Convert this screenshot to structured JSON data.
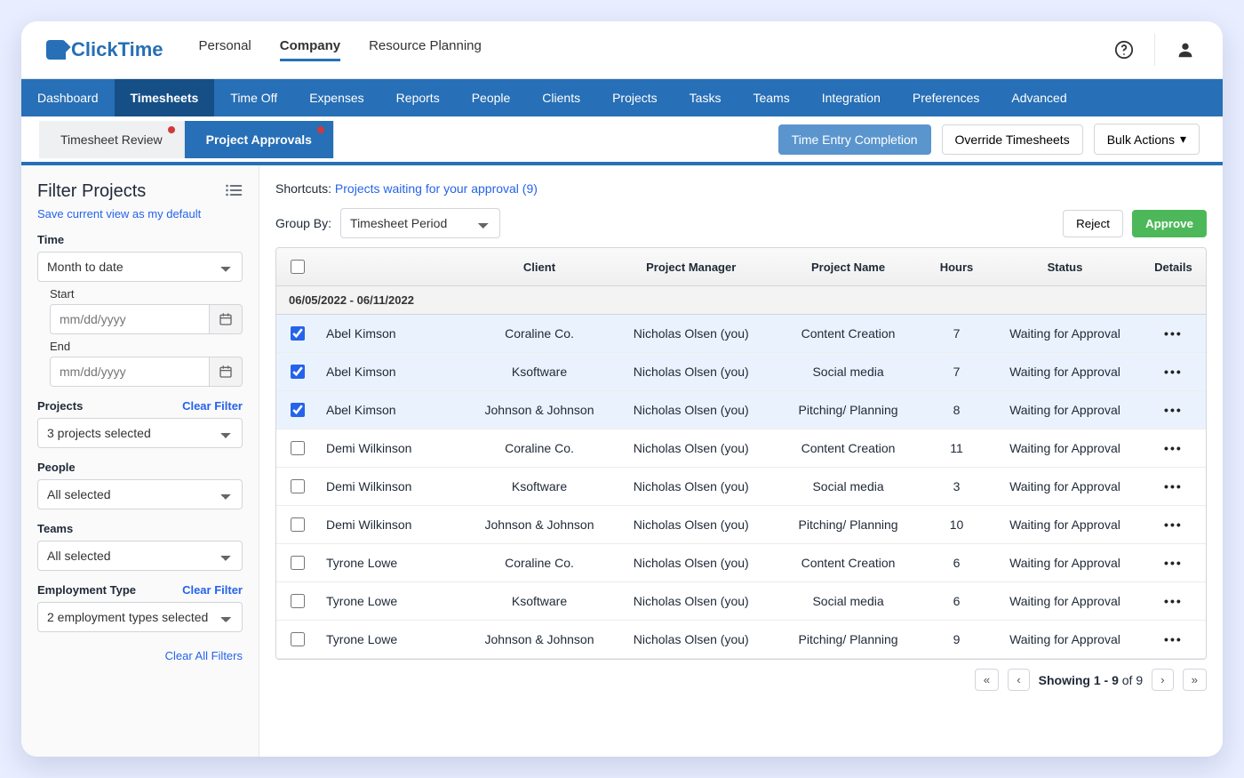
{
  "brand": "ClickTime",
  "topnav": {
    "items": [
      "Personal",
      "Company",
      "Resource Planning"
    ],
    "active": 1
  },
  "navbar": {
    "items": [
      "Dashboard",
      "Timesheets",
      "Time Off",
      "Expenses",
      "Reports",
      "People",
      "Clients",
      "Projects",
      "Tasks",
      "Teams",
      "Integration",
      "Preferences",
      "Advanced"
    ],
    "active": 1
  },
  "subtabs": {
    "items": [
      {
        "label": "Timesheet Review",
        "badge": true
      },
      {
        "label": "Project Approvals",
        "badge": true
      }
    ],
    "active": 1
  },
  "subbar_buttons": {
    "time_entry": "Time Entry Completion",
    "override": "Override Timesheets",
    "bulk": "Bulk Actions"
  },
  "sidebar": {
    "title": "Filter Projects",
    "save_default": "Save current view as my default",
    "clear_filter": "Clear Filter",
    "clear_all": "Clear All Filters",
    "time": {
      "label": "Time",
      "value": "Month to date",
      "start_label": "Start",
      "end_label": "End",
      "date_ph": "mm/dd/yyyy"
    },
    "projects": {
      "label": "Projects",
      "value": "3 projects selected"
    },
    "people": {
      "label": "People",
      "value": "All selected"
    },
    "teams": {
      "label": "Teams",
      "value": "All selected"
    },
    "emp_type": {
      "label": "Employment Type",
      "value": "2 employment types selected"
    }
  },
  "main": {
    "shortcut_label": "Shortcuts:",
    "shortcut_link": "Projects waiting for your approval (9)",
    "groupby_label": "Group By:",
    "groupby_value": "Timesheet Period",
    "reject": "Reject",
    "approve": "Approve"
  },
  "table": {
    "headers": [
      "",
      "",
      "Client",
      "Project Manager",
      "Project Name",
      "Hours",
      "Status",
      "Details"
    ],
    "group": "06/05/2022 - 06/11/2022",
    "rows": [
      {
        "sel": true,
        "person": "Abel Kimson",
        "client": "Coraline Co.",
        "pm": "Nicholas Olsen (you)",
        "project": "Content Creation",
        "hours": "7",
        "status": "Waiting for Approval"
      },
      {
        "sel": true,
        "person": "Abel Kimson",
        "client": "Ksoftware",
        "pm": "Nicholas Olsen (you)",
        "project": "Social media",
        "hours": "7",
        "status": "Waiting for Approval"
      },
      {
        "sel": true,
        "person": "Abel Kimson",
        "client": "Johnson & Johnson",
        "pm": "Nicholas Olsen (you)",
        "project": "Pitching/ Planning",
        "hours": "8",
        "status": "Waiting for Approval"
      },
      {
        "sel": false,
        "person": "Demi Wilkinson",
        "client": "Coraline Co.",
        "pm": "Nicholas Olsen (you)",
        "project": "Content Creation",
        "hours": "11",
        "status": "Waiting for Approval"
      },
      {
        "sel": false,
        "person": "Demi Wilkinson",
        "client": "Ksoftware",
        "pm": "Nicholas Olsen (you)",
        "project": "Social media",
        "hours": "3",
        "status": "Waiting for Approval"
      },
      {
        "sel": false,
        "person": "Demi Wilkinson",
        "client": "Johnson & Johnson",
        "pm": "Nicholas Olsen (you)",
        "project": "Pitching/ Planning",
        "hours": "10",
        "status": "Waiting for Approval"
      },
      {
        "sel": false,
        "person": "Tyrone Lowe",
        "client": "Coraline Co.",
        "pm": "Nicholas Olsen (you)",
        "project": "Content Creation",
        "hours": "6",
        "status": "Waiting for Approval"
      },
      {
        "sel": false,
        "person": "Tyrone Lowe",
        "client": "Ksoftware",
        "pm": "Nicholas Olsen (you)",
        "project": "Social media",
        "hours": "6",
        "status": "Waiting for Approval"
      },
      {
        "sel": false,
        "person": "Tyrone Lowe",
        "client": "Johnson & Johnson",
        "pm": "Nicholas Olsen (you)",
        "project": "Pitching/ Planning",
        "hours": "9",
        "status": "Waiting for Approval"
      }
    ]
  },
  "pager": {
    "showing": "Showing ",
    "range": "1 - 9",
    "of": " of 9"
  }
}
